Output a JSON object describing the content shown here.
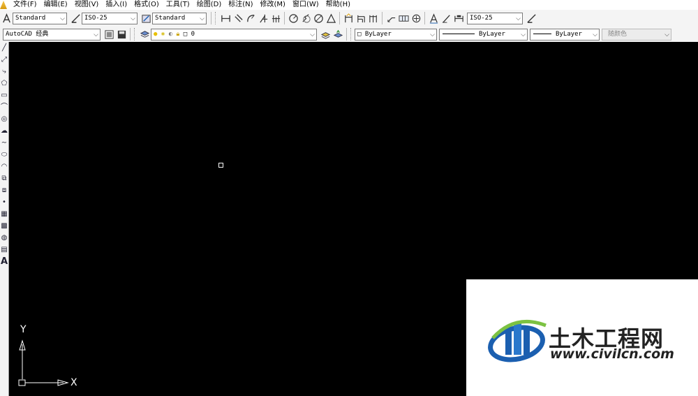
{
  "menubar": {
    "items": [
      "文件(F)",
      "编辑(E)",
      "视图(V)",
      "插入(I)",
      "格式(O)",
      "工具(T)",
      "绘图(D)",
      "标注(N)",
      "修改(M)",
      "窗口(W)",
      "帮助(H)"
    ]
  },
  "styles_toolbar": {
    "text_style": "Standard",
    "dim_style": "ISO-25",
    "table_style": "Standard",
    "dim_style_2": "ISO-25"
  },
  "workspace_toolbar": {
    "workspace": "AutoCAD 经典",
    "layer_name": "0",
    "color": "ByLayer",
    "linetype": "ByLayer",
    "lineweight": "ByLayer",
    "plot_style": "随颜色"
  },
  "ucs": {
    "y_label": "Y",
    "x_label": "X"
  },
  "watermark": {
    "title": "土木工程网",
    "url": "www.civilcn.com"
  },
  "colors": {
    "canvas": "#000000",
    "toolbar": "#f4f4f4",
    "logo_blue": "#1b5fb0",
    "logo_green": "#7cc242"
  }
}
